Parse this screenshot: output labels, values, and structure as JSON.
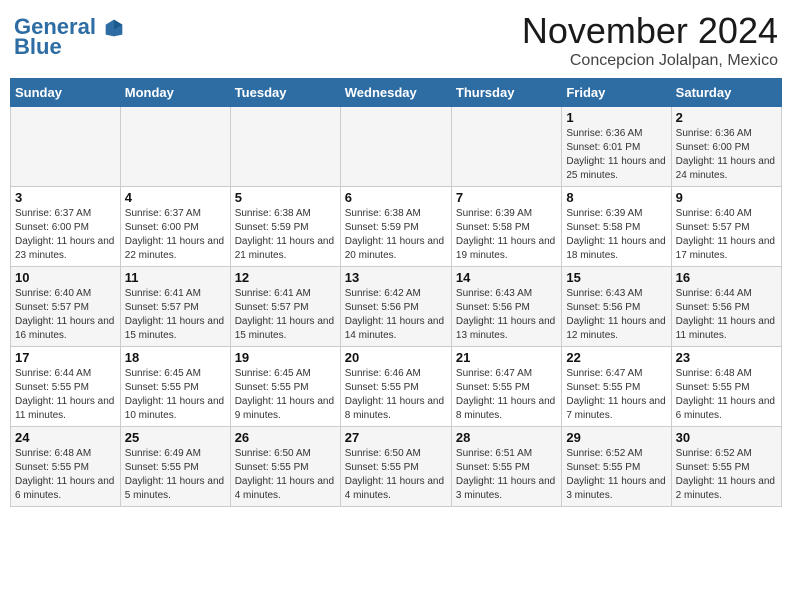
{
  "header": {
    "logo_general": "General",
    "logo_blue": "Blue",
    "month_title": "November 2024",
    "location": "Concepcion Jolalpan, Mexico"
  },
  "weekdays": [
    "Sunday",
    "Monday",
    "Tuesday",
    "Wednesday",
    "Thursday",
    "Friday",
    "Saturday"
  ],
  "weeks": [
    [
      {
        "day": "",
        "info": ""
      },
      {
        "day": "",
        "info": ""
      },
      {
        "day": "",
        "info": ""
      },
      {
        "day": "",
        "info": ""
      },
      {
        "day": "",
        "info": ""
      },
      {
        "day": "1",
        "info": "Sunrise: 6:36 AM\nSunset: 6:01 PM\nDaylight: 11 hours and 25 minutes."
      },
      {
        "day": "2",
        "info": "Sunrise: 6:36 AM\nSunset: 6:00 PM\nDaylight: 11 hours and 24 minutes."
      }
    ],
    [
      {
        "day": "3",
        "info": "Sunrise: 6:37 AM\nSunset: 6:00 PM\nDaylight: 11 hours and 23 minutes."
      },
      {
        "day": "4",
        "info": "Sunrise: 6:37 AM\nSunset: 6:00 PM\nDaylight: 11 hours and 22 minutes."
      },
      {
        "day": "5",
        "info": "Sunrise: 6:38 AM\nSunset: 5:59 PM\nDaylight: 11 hours and 21 minutes."
      },
      {
        "day": "6",
        "info": "Sunrise: 6:38 AM\nSunset: 5:59 PM\nDaylight: 11 hours and 20 minutes."
      },
      {
        "day": "7",
        "info": "Sunrise: 6:39 AM\nSunset: 5:58 PM\nDaylight: 11 hours and 19 minutes."
      },
      {
        "day": "8",
        "info": "Sunrise: 6:39 AM\nSunset: 5:58 PM\nDaylight: 11 hours and 18 minutes."
      },
      {
        "day": "9",
        "info": "Sunrise: 6:40 AM\nSunset: 5:57 PM\nDaylight: 11 hours and 17 minutes."
      }
    ],
    [
      {
        "day": "10",
        "info": "Sunrise: 6:40 AM\nSunset: 5:57 PM\nDaylight: 11 hours and 16 minutes."
      },
      {
        "day": "11",
        "info": "Sunrise: 6:41 AM\nSunset: 5:57 PM\nDaylight: 11 hours and 15 minutes."
      },
      {
        "day": "12",
        "info": "Sunrise: 6:41 AM\nSunset: 5:57 PM\nDaylight: 11 hours and 15 minutes."
      },
      {
        "day": "13",
        "info": "Sunrise: 6:42 AM\nSunset: 5:56 PM\nDaylight: 11 hours and 14 minutes."
      },
      {
        "day": "14",
        "info": "Sunrise: 6:43 AM\nSunset: 5:56 PM\nDaylight: 11 hours and 13 minutes."
      },
      {
        "day": "15",
        "info": "Sunrise: 6:43 AM\nSunset: 5:56 PM\nDaylight: 11 hours and 12 minutes."
      },
      {
        "day": "16",
        "info": "Sunrise: 6:44 AM\nSunset: 5:56 PM\nDaylight: 11 hours and 11 minutes."
      }
    ],
    [
      {
        "day": "17",
        "info": "Sunrise: 6:44 AM\nSunset: 5:55 PM\nDaylight: 11 hours and 11 minutes."
      },
      {
        "day": "18",
        "info": "Sunrise: 6:45 AM\nSunset: 5:55 PM\nDaylight: 11 hours and 10 minutes."
      },
      {
        "day": "19",
        "info": "Sunrise: 6:45 AM\nSunset: 5:55 PM\nDaylight: 11 hours and 9 minutes."
      },
      {
        "day": "20",
        "info": "Sunrise: 6:46 AM\nSunset: 5:55 PM\nDaylight: 11 hours and 8 minutes."
      },
      {
        "day": "21",
        "info": "Sunrise: 6:47 AM\nSunset: 5:55 PM\nDaylight: 11 hours and 8 minutes."
      },
      {
        "day": "22",
        "info": "Sunrise: 6:47 AM\nSunset: 5:55 PM\nDaylight: 11 hours and 7 minutes."
      },
      {
        "day": "23",
        "info": "Sunrise: 6:48 AM\nSunset: 5:55 PM\nDaylight: 11 hours and 6 minutes."
      }
    ],
    [
      {
        "day": "24",
        "info": "Sunrise: 6:48 AM\nSunset: 5:55 PM\nDaylight: 11 hours and 6 minutes."
      },
      {
        "day": "25",
        "info": "Sunrise: 6:49 AM\nSunset: 5:55 PM\nDaylight: 11 hours and 5 minutes."
      },
      {
        "day": "26",
        "info": "Sunrise: 6:50 AM\nSunset: 5:55 PM\nDaylight: 11 hours and 4 minutes."
      },
      {
        "day": "27",
        "info": "Sunrise: 6:50 AM\nSunset: 5:55 PM\nDaylight: 11 hours and 4 minutes."
      },
      {
        "day": "28",
        "info": "Sunrise: 6:51 AM\nSunset: 5:55 PM\nDaylight: 11 hours and 3 minutes."
      },
      {
        "day": "29",
        "info": "Sunrise: 6:52 AM\nSunset: 5:55 PM\nDaylight: 11 hours and 3 minutes."
      },
      {
        "day": "30",
        "info": "Sunrise: 6:52 AM\nSunset: 5:55 PM\nDaylight: 11 hours and 2 minutes."
      }
    ]
  ]
}
